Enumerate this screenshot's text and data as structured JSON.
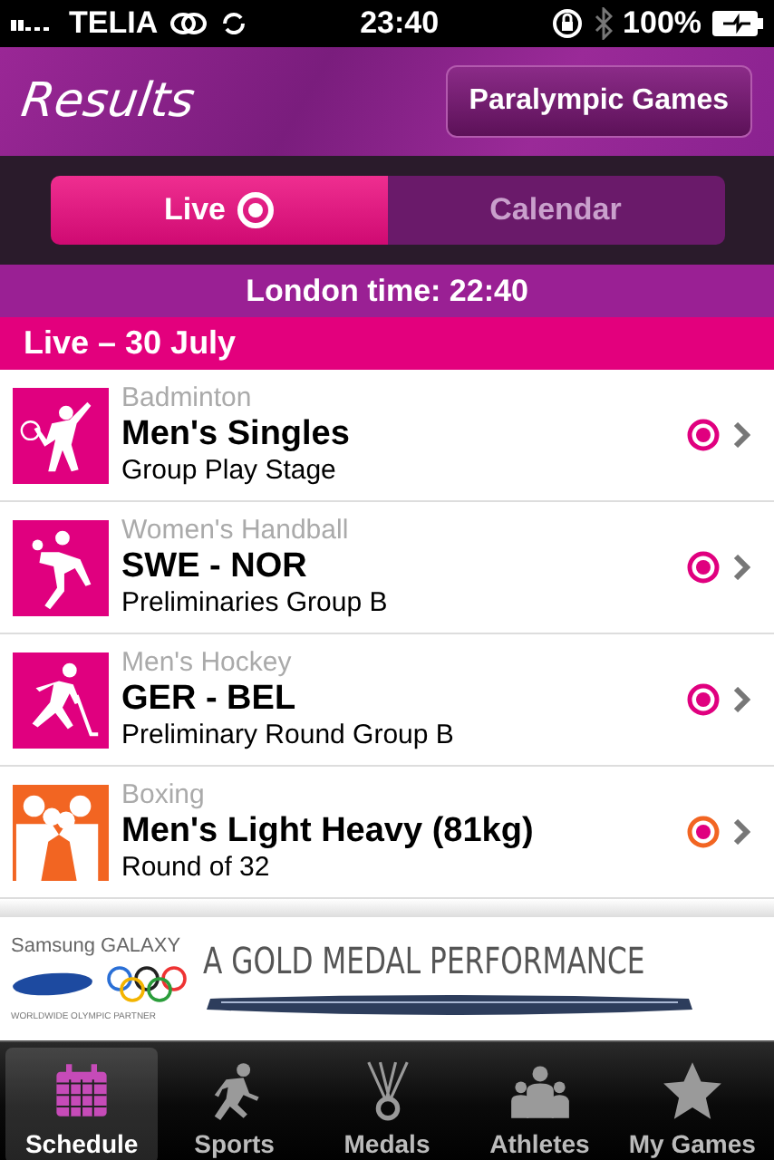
{
  "status_bar": {
    "carrier": "TELIA",
    "time": "23:40",
    "battery": "100%"
  },
  "header": {
    "title": "Results",
    "button": "Paralympic Games"
  },
  "segments": [
    {
      "label": "Live",
      "selected": true
    },
    {
      "label": "Calendar",
      "selected": false
    }
  ],
  "london_time": "London time: 22:40",
  "section": "Live – 30 July",
  "events": [
    {
      "sport": "Badminton",
      "title": "Men's Singles",
      "stage": "Group Play Stage",
      "color": "#e0007f",
      "live": true
    },
    {
      "sport": "Women's Handball",
      "title": "SWE - NOR",
      "stage": "Preliminaries Group B",
      "color": "#e0007f",
      "live": true
    },
    {
      "sport": "Men's Hockey",
      "title": "GER - BEL",
      "stage": "Preliminary Round Group B",
      "color": "#e0007f",
      "live": true
    },
    {
      "sport": "Boxing",
      "title": "Men's Light Heavy (81kg)",
      "stage": "Round of 32",
      "color": "#f26522",
      "live": true
    }
  ],
  "ad": {
    "brand": "Samsung GALAXY",
    "headline": "A GOLD MEDAL PERFORMANCE",
    "tagline": "WORLDWIDE OLYMPIC PARTNER"
  },
  "tabs": [
    {
      "label": "Schedule",
      "selected": true
    },
    {
      "label": "Sports",
      "selected": false
    },
    {
      "label": "Medals",
      "selected": false
    },
    {
      "label": "Athletes",
      "selected": false
    },
    {
      "label": "My Games",
      "selected": false
    }
  ]
}
